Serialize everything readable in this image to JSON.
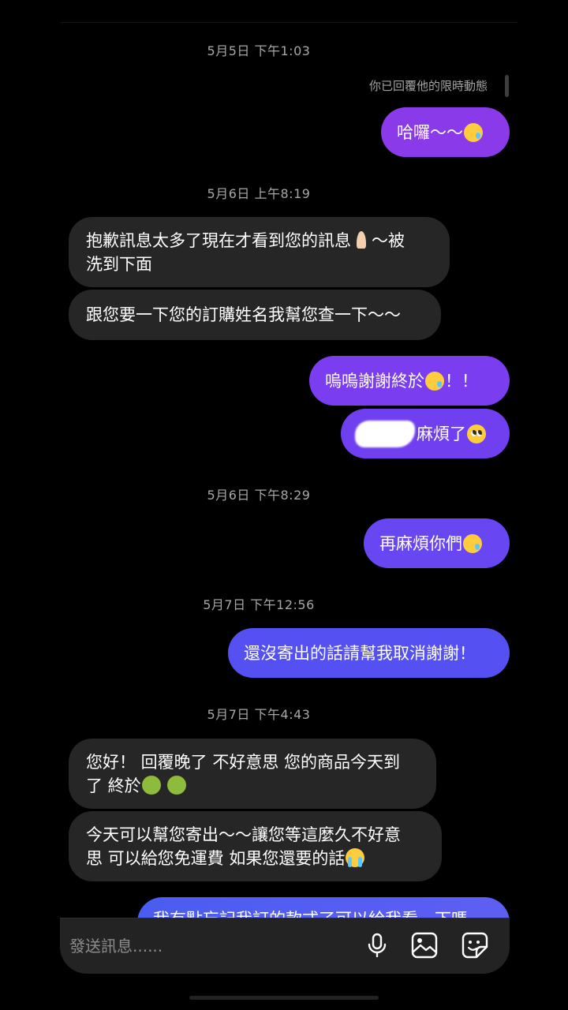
{
  "timestamps": [
    "5月5日 下午1:03",
    "5月6日 上午8:19",
    "5月6日 下午8:29",
    "5月7日 下午12:56",
    "5月7日 下午4:43"
  ],
  "reply_note": "你已回覆他的限時動態",
  "messages": {
    "m1": {
      "text": "哈囉～～",
      "emoji": "smiling-face-with-tear"
    },
    "m2": {
      "line1": "抱歉訊息太多了現在才看到您的訊息",
      "emoji": "folded-hands",
      "line1_tail": "～被",
      "line2": "洗到下面"
    },
    "m3": {
      "text": "跟您要一下您的訂購姓名我幫您查一下～～"
    },
    "m4": {
      "text_a": "嗚嗚謝謝終於",
      "emoji": "smiling-face-with-tear",
      "text_b": "！！"
    },
    "m5": {
      "text": "麻煩了",
      "emoji": "pleading-face"
    },
    "m6": {
      "text": "再麻煩你們",
      "emoji": "smiling-face-with-tear"
    },
    "m7": {
      "text": "還沒寄出的話請幫我取消謝謝！"
    },
    "m8": {
      "line1": "您好！ 回覆晚了 不好意思 您的商品今天到",
      "line2": "了 終於",
      "emoji": "nauseated-face"
    },
    "m9": {
      "line1": "今天可以幫您寄出～～讓您等這麼久不好意",
      "line2": "思 可以給您免運費 如果您還要的話",
      "emoji": "loudly-crying-face"
    },
    "m10": {
      "text": "我有點忘記我訂的款式了可以給我看一下嗎"
    }
  },
  "composer": {
    "placeholder": "發送訊息......",
    "icons": [
      "microphone-icon",
      "image-icon",
      "sticker-icon"
    ]
  },
  "colors": {
    "background": "#000000",
    "incoming": "#262626",
    "outgoing_purple": "#7a3cf0",
    "outgoing_blue": "#4a5df0"
  }
}
